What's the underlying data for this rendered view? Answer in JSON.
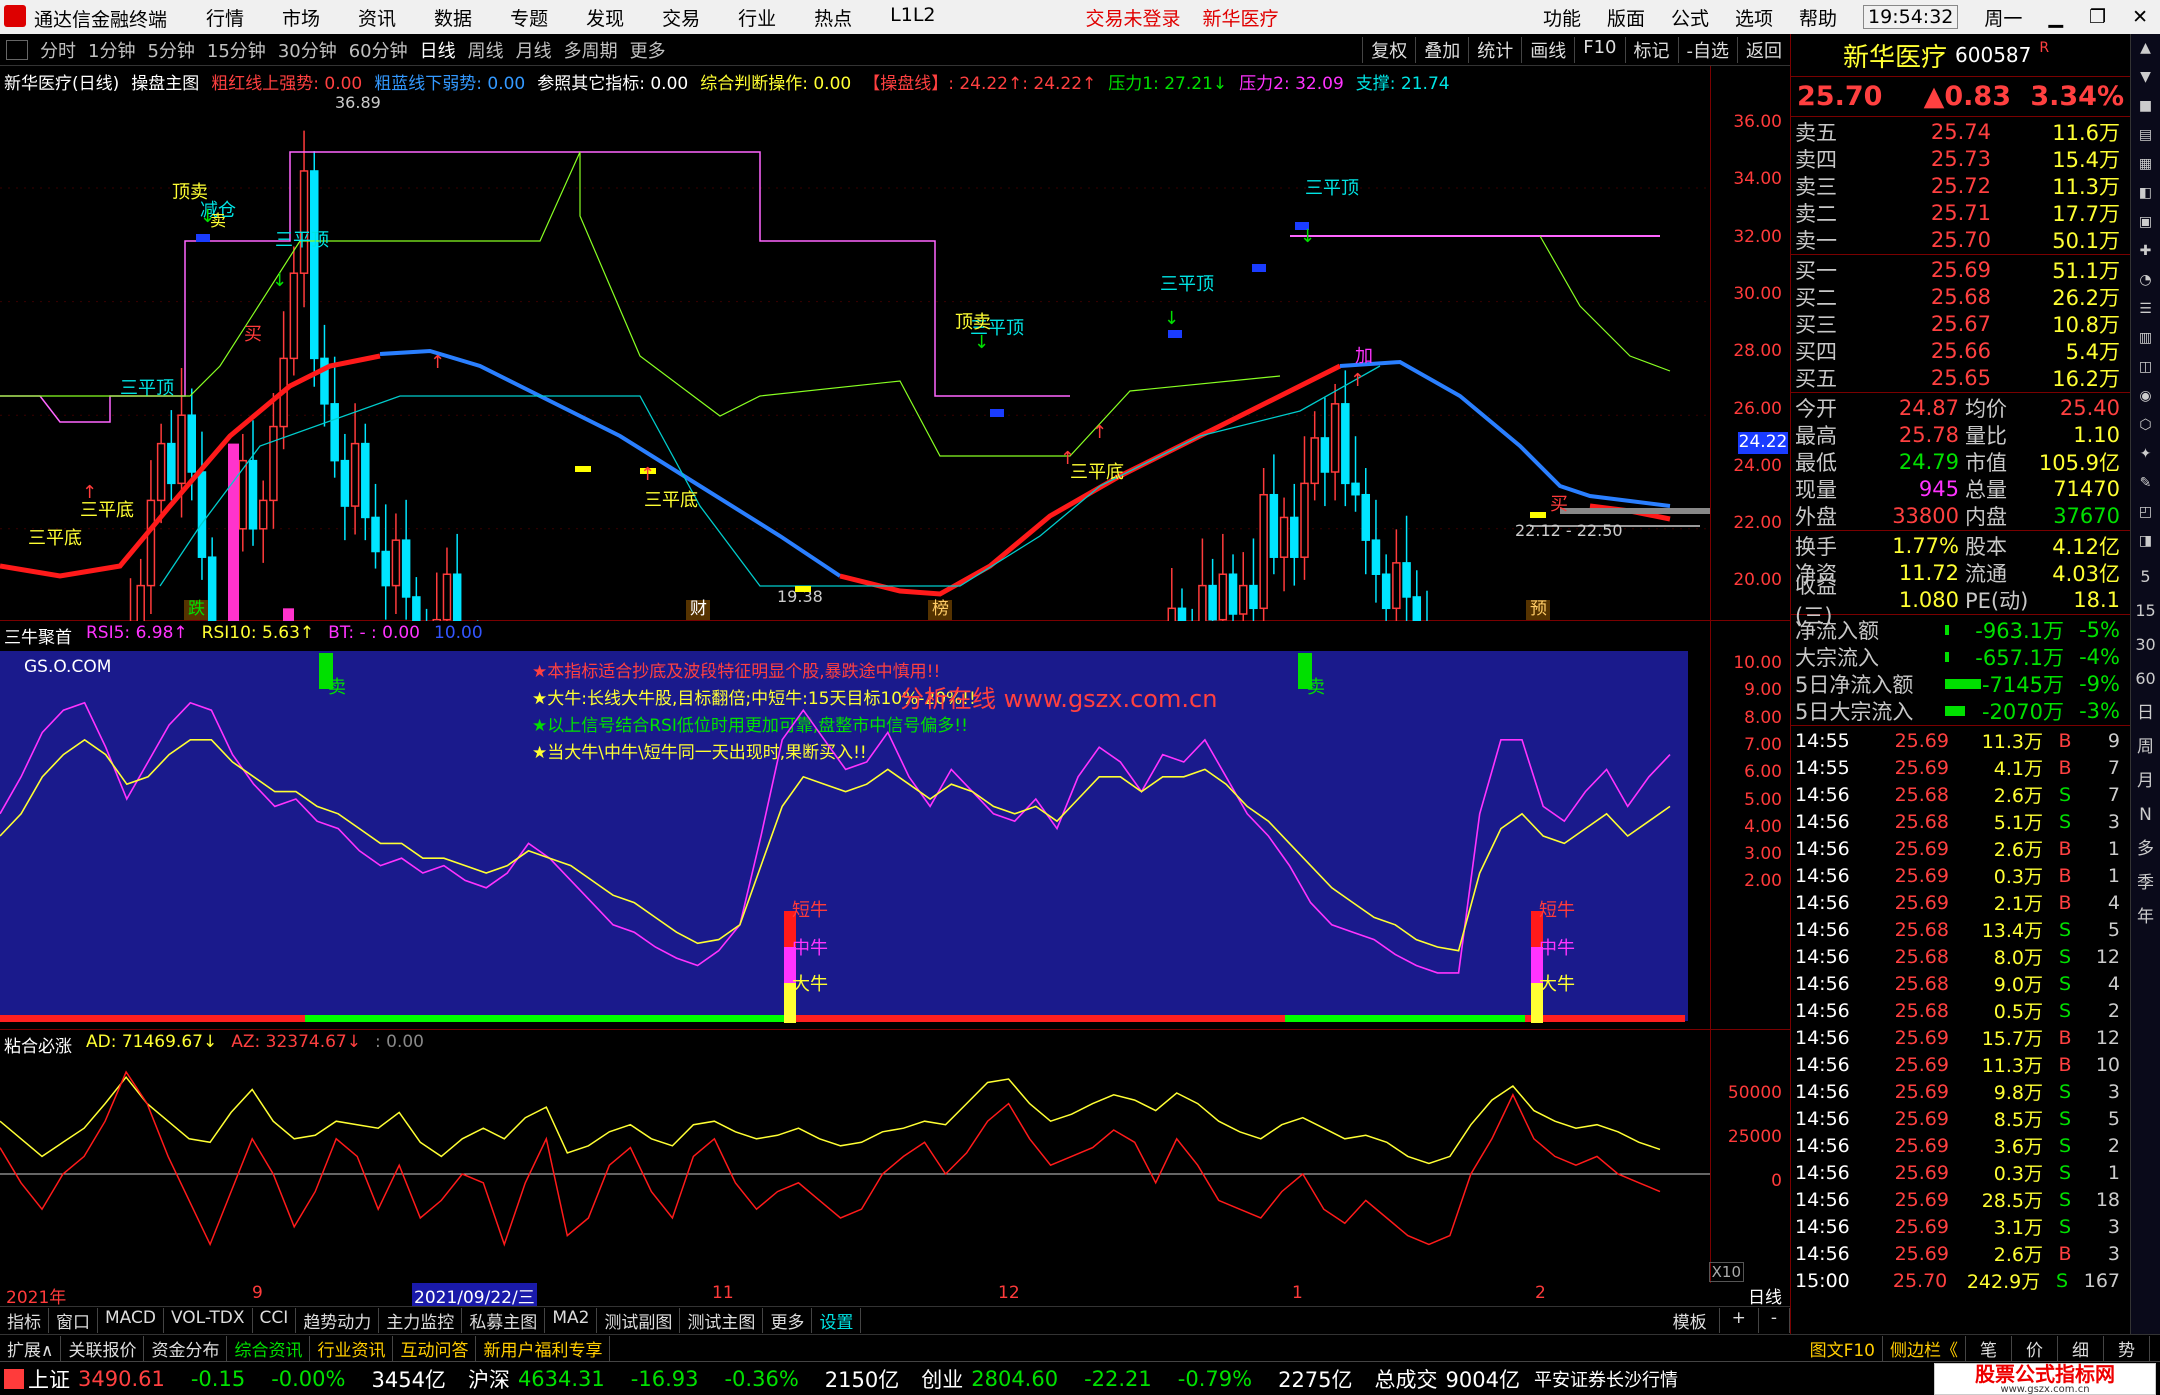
{
  "titlebar": {
    "app": "通达信金融终端",
    "menus": [
      "行情",
      "市场",
      "资讯",
      "数据",
      "专题",
      "发现",
      "交易",
      "行业",
      "热点",
      "L1L2"
    ],
    "warn1": "交易未登录",
    "warn2": "新华医疗",
    "right": [
      "功能",
      "版面",
      "公式",
      "选项",
      "帮助"
    ],
    "time": "19:54:32",
    "weekday": "周一"
  },
  "periods": [
    "分时",
    "1分钟",
    "5分钟",
    "15分钟",
    "30分钟",
    "60分钟",
    "日线",
    "周线",
    "月线",
    "多周期",
    "更多"
  ],
  "tools": [
    "复权",
    "叠加",
    "统计",
    "画线",
    "F10",
    "标记",
    "-自选",
    "返回"
  ],
  "main": {
    "head": {
      "name": "新华医疗(日线)",
      "formula": "操盘主图",
      "t1": "粗红线上强势: 0.00",
      "t2": "粗蓝线下弱势: 0.00",
      "t3": "参照其它指标: 0.00",
      "t4": "综合判断操作: 0.00",
      "t5": "【操盘线】: 24.22↑: 24.22↑",
      "t6": "压力1: 27.21↓",
      "t7": "压力2: 32.09",
      "t8": "支撑: 21.74"
    },
    "yticks": [
      "36.00",
      "34.00",
      "32.00",
      "30.00",
      "28.00",
      "26.00",
      "24.00",
      "22.00",
      "20.00"
    ],
    "cur_price": "24.22",
    "labels": {
      "hi": "36.89",
      "lo": "19.38",
      "range": "22.12 - 22.50",
      "san_ping_di": "三平底",
      "san_ping_ding": "三平顶",
      "ding_mai": "顶卖",
      "jian_cang": "减仓",
      "mai": "卖",
      "mai2": "买",
      "jia": "加",
      "die": "跌",
      "cai": "财",
      "bang": "榜",
      "yu": "预",
      "ji_dan": "ⓘ"
    }
  },
  "sub1": {
    "name": "三牛聚首",
    "rsi5": "RSI5: 6.98↑",
    "rsi10": "RSI10: 5.63↑",
    "bt": "BT: - : 0.00",
    "v10": "10.00",
    "site": "GS.O.COM",
    "n1": "★本指标适合抄底及波段特征明显个股,暴跌途中慎用!!",
    "n2": "★大牛:长线大牛股,目标翻倍;中短牛:15天目标10%-20%!!",
    "n3": "★以上信号结合RSI低位时用更加可靠,盘整市中信号偏多!!",
    "n4": "★当大牛\\中牛\\短牛同一天出现时,果断买入!!",
    "watermark": "分析在线  www.gszx.com.cn",
    "duan": "短牛",
    "zhong": "中牛",
    "da": "大牛",
    "sell": "卖",
    "yticks": [
      "10.00",
      "9.00",
      "8.00",
      "7.00",
      "6.00",
      "5.00",
      "4.00",
      "3.00",
      "2.00"
    ]
  },
  "sub2": {
    "name": "粘合必涨",
    "ad": "AD: 71469.67↓",
    "az": "AZ: 32374.67↓",
    "v": ": 0.00",
    "yticks": [
      "50000",
      "25000",
      "0"
    ],
    "x10": "X10"
  },
  "xaxis": {
    "labels": [
      "2021年",
      "9",
      "2021/09/22/三",
      "11",
      "12",
      "1",
      "2"
    ],
    "right": "日线"
  },
  "tabs": [
    "指标",
    "窗口",
    "MACD",
    "VOL-TDX",
    "CCI",
    "趋势动力",
    "主力监控",
    "私募主图",
    "MA2",
    "测试副图",
    "测试主图",
    "更多",
    "设置"
  ],
  "tabs_right": [
    "模板",
    "+",
    "-"
  ],
  "bottomtabs": [
    "扩展∧",
    "关联报价",
    "资金分布",
    "综合资讯",
    "行业资讯",
    "互动问答",
    "新用户福利专享"
  ],
  "bottomright": [
    "图文F10",
    "侧边栏《",
    "笔",
    "价",
    "细",
    "势"
  ],
  "quote": {
    "name": "新华医疗",
    "code": "600587",
    "flag": "R",
    "price": "25.70",
    "chg": "▲0.83",
    "pct": "3.34%",
    "asks": [
      [
        "卖五",
        "25.74",
        "11.6万"
      ],
      [
        "卖四",
        "25.73",
        "15.4万"
      ],
      [
        "卖三",
        "25.72",
        "11.3万"
      ],
      [
        "卖二",
        "25.71",
        "17.7万"
      ],
      [
        "卖一",
        "25.70",
        "50.1万"
      ]
    ],
    "bids": [
      [
        "买一",
        "25.69",
        "51.1万"
      ],
      [
        "买二",
        "25.68",
        "26.2万"
      ],
      [
        "买三",
        "25.67",
        "10.8万"
      ],
      [
        "买四",
        "25.66",
        "5.4万"
      ],
      [
        "买五",
        "25.65",
        "16.2万"
      ]
    ],
    "stats": [
      [
        "今开",
        "24.87",
        "均价",
        "25.40"
      ],
      [
        "最高",
        "25.78",
        "量比",
        "1.10"
      ],
      [
        "最低",
        "24.79",
        "市值",
        "105.9亿"
      ],
      [
        "现量",
        "945",
        "总量",
        "71470"
      ],
      [
        "外盘",
        "33800",
        "内盘",
        "37670"
      ]
    ],
    "stats2": [
      [
        "换手",
        "1.77%",
        "股本",
        "4.12亿"
      ],
      [
        "净资",
        "11.72",
        "流通",
        "4.03亿"
      ],
      [
        "收益(三)",
        "1.080",
        "PE(动)",
        "18.1"
      ]
    ],
    "flows": [
      [
        "净流入额",
        "-963.1万",
        "-5%"
      ],
      [
        "大宗流入",
        "-657.1万",
        "-4%"
      ],
      [
        "5日净流入额",
        "-7145万",
        "-9%"
      ],
      [
        "5日大宗流入",
        "-2070万",
        "-3%"
      ]
    ],
    "ticks": [
      [
        "14:55",
        "25.69",
        "11.3万",
        "B",
        "9"
      ],
      [
        "14:55",
        "25.69",
        "4.1万",
        "B",
        "7"
      ],
      [
        "14:56",
        "25.68",
        "2.6万",
        "S",
        "7"
      ],
      [
        "14:56",
        "25.68",
        "5.1万",
        "S",
        "3"
      ],
      [
        "14:56",
        "25.69",
        "2.6万",
        "B",
        "1"
      ],
      [
        "14:56",
        "25.69",
        "0.3万",
        "B",
        "1"
      ],
      [
        "14:56",
        "25.69",
        "2.1万",
        "B",
        "4"
      ],
      [
        "14:56",
        "25.68",
        "13.4万",
        "S",
        "5"
      ],
      [
        "14:56",
        "25.68",
        "8.0万",
        "S",
        "12"
      ],
      [
        "14:56",
        "25.68",
        "9.0万",
        "S",
        "4"
      ],
      [
        "14:56",
        "25.68",
        "0.5万",
        "S",
        "2"
      ],
      [
        "14:56",
        "25.69",
        "15.7万",
        "B",
        "12"
      ],
      [
        "14:56",
        "25.69",
        "11.3万",
        "B",
        "10"
      ],
      [
        "14:56",
        "25.69",
        "9.8万",
        "S",
        "3"
      ],
      [
        "14:56",
        "25.69",
        "8.5万",
        "S",
        "5"
      ],
      [
        "14:56",
        "25.69",
        "3.6万",
        "S",
        "2"
      ],
      [
        "14:56",
        "25.69",
        "0.3万",
        "S",
        "1"
      ],
      [
        "14:56",
        "25.69",
        "28.5万",
        "S",
        "18"
      ],
      [
        "14:56",
        "25.69",
        "3.1万",
        "S",
        "3"
      ],
      [
        "14:56",
        "25.69",
        "2.6万",
        "B",
        "3"
      ],
      [
        "15:00",
        "25.70",
        "242.9万",
        "S",
        "167"
      ]
    ]
  },
  "sidebar": [
    "日",
    "周",
    "月",
    "N",
    "多",
    "季",
    "年"
  ],
  "sidebar_nums": [
    "5",
    "15",
    "30",
    "60"
  ],
  "status": {
    "sh_label": "上证",
    "sh": "3490.61",
    "sh_chg": "-0.15",
    "sh_pct": "-0.00%",
    "sh_amt": "3454亿",
    "hs_label": "沪深",
    "hs": "4634.31",
    "hs_chg": "-16.93",
    "hs_pct": "-0.36%",
    "hs_amt": "2150亿",
    "cy_label": "创业",
    "cy": "2804.60",
    "cy_chg": "-22.21",
    "cy_pct": "-0.79%",
    "cy_amt": "2275亿",
    "total_label": "总成交",
    "total": "9004亿",
    "broker": "平安证券长沙行情",
    "logo": "股票公式指标网",
    "logo_url": "www.gszx.com.cn"
  },
  "colors": {
    "up": "#ff3b3b",
    "down": "#00e5ff",
    "ma_red": "#ff1a1a",
    "ma_blue": "#2a7fff",
    "bg_sub": "#1a1a8c"
  }
}
